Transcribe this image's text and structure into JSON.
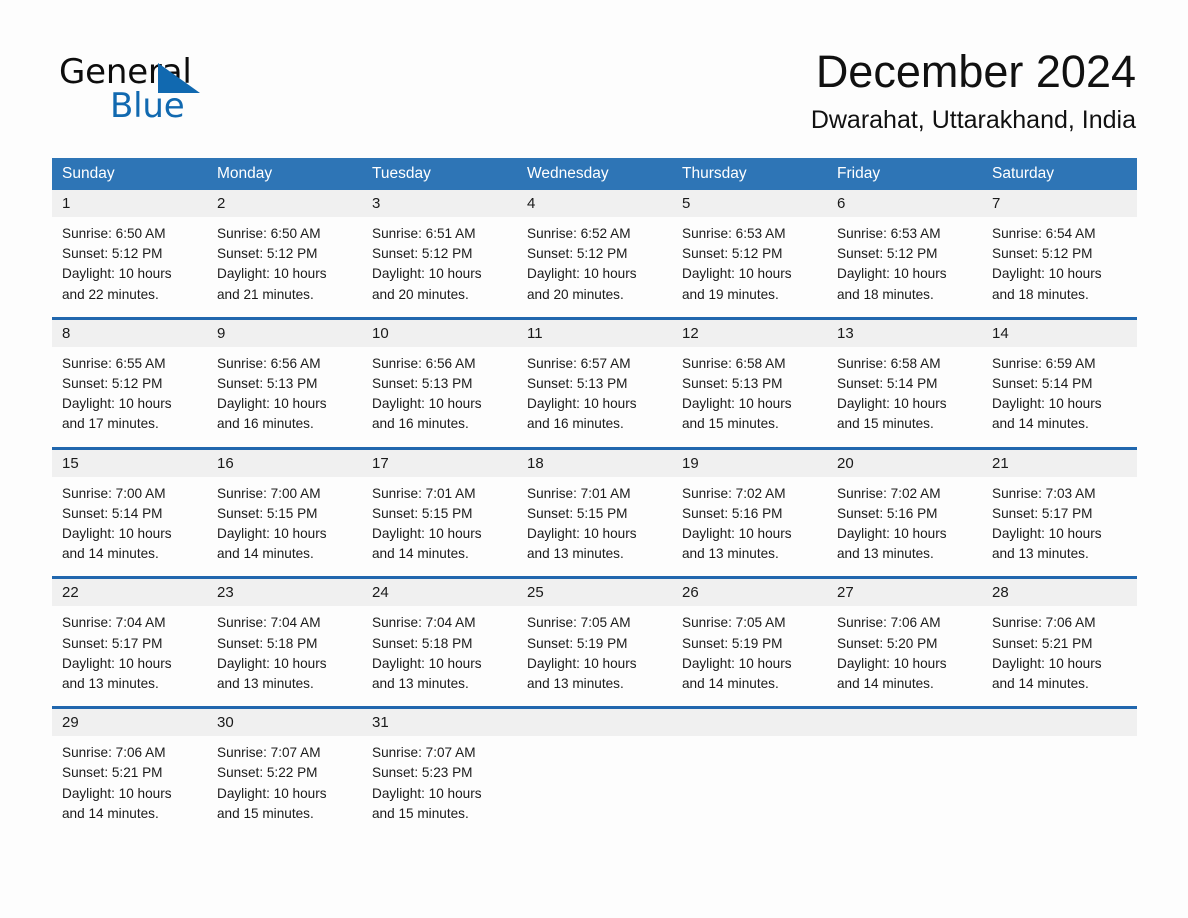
{
  "logo": {
    "word_one": "General",
    "word_two": "Blue",
    "triangle_icon": "triangle-icon",
    "accent_color": "#1169b0"
  },
  "header": {
    "month_title": "December 2024",
    "location": "Dwarahat, Uttarakhand, India"
  },
  "colors": {
    "header_blue": "#2e75b6",
    "row_border_blue": "#2167ae",
    "day_band_gray": "#f0f0f0",
    "page_background": "#fdfdfd"
  },
  "calendar": {
    "weekdays": [
      "Sunday",
      "Monday",
      "Tuesday",
      "Wednesday",
      "Thursday",
      "Friday",
      "Saturday"
    ],
    "weeks": [
      {
        "days": [
          {
            "date": "1",
            "sunrise": "Sunrise: 6:50 AM",
            "sunset": "Sunset: 5:12 PM",
            "daylight_line1": "Daylight: 10 hours",
            "daylight_line2": "and 22 minutes."
          },
          {
            "date": "2",
            "sunrise": "Sunrise: 6:50 AM",
            "sunset": "Sunset: 5:12 PM",
            "daylight_line1": "Daylight: 10 hours",
            "daylight_line2": "and 21 minutes."
          },
          {
            "date": "3",
            "sunrise": "Sunrise: 6:51 AM",
            "sunset": "Sunset: 5:12 PM",
            "daylight_line1": "Daylight: 10 hours",
            "daylight_line2": "and 20 minutes."
          },
          {
            "date": "4",
            "sunrise": "Sunrise: 6:52 AM",
            "sunset": "Sunset: 5:12 PM",
            "daylight_line1": "Daylight: 10 hours",
            "daylight_line2": "and 20 minutes."
          },
          {
            "date": "5",
            "sunrise": "Sunrise: 6:53 AM",
            "sunset": "Sunset: 5:12 PM",
            "daylight_line1": "Daylight: 10 hours",
            "daylight_line2": "and 19 minutes."
          },
          {
            "date": "6",
            "sunrise": "Sunrise: 6:53 AM",
            "sunset": "Sunset: 5:12 PM",
            "daylight_line1": "Daylight: 10 hours",
            "daylight_line2": "and 18 minutes."
          },
          {
            "date": "7",
            "sunrise": "Sunrise: 6:54 AM",
            "sunset": "Sunset: 5:12 PM",
            "daylight_line1": "Daylight: 10 hours",
            "daylight_line2": "and 18 minutes."
          }
        ]
      },
      {
        "days": [
          {
            "date": "8",
            "sunrise": "Sunrise: 6:55 AM",
            "sunset": "Sunset: 5:12 PM",
            "daylight_line1": "Daylight: 10 hours",
            "daylight_line2": "and 17 minutes."
          },
          {
            "date": "9",
            "sunrise": "Sunrise: 6:56 AM",
            "sunset": "Sunset: 5:13 PM",
            "daylight_line1": "Daylight: 10 hours",
            "daylight_line2": "and 16 minutes."
          },
          {
            "date": "10",
            "sunrise": "Sunrise: 6:56 AM",
            "sunset": "Sunset: 5:13 PM",
            "daylight_line1": "Daylight: 10 hours",
            "daylight_line2": "and 16 minutes."
          },
          {
            "date": "11",
            "sunrise": "Sunrise: 6:57 AM",
            "sunset": "Sunset: 5:13 PM",
            "daylight_line1": "Daylight: 10 hours",
            "daylight_line2": "and 16 minutes."
          },
          {
            "date": "12",
            "sunrise": "Sunrise: 6:58 AM",
            "sunset": "Sunset: 5:13 PM",
            "daylight_line1": "Daylight: 10 hours",
            "daylight_line2": "and 15 minutes."
          },
          {
            "date": "13",
            "sunrise": "Sunrise: 6:58 AM",
            "sunset": "Sunset: 5:14 PM",
            "daylight_line1": "Daylight: 10 hours",
            "daylight_line2": "and 15 minutes."
          },
          {
            "date": "14",
            "sunrise": "Sunrise: 6:59 AM",
            "sunset": "Sunset: 5:14 PM",
            "daylight_line1": "Daylight: 10 hours",
            "daylight_line2": "and 14 minutes."
          }
        ]
      },
      {
        "days": [
          {
            "date": "15",
            "sunrise": "Sunrise: 7:00 AM",
            "sunset": "Sunset: 5:14 PM",
            "daylight_line1": "Daylight: 10 hours",
            "daylight_line2": "and 14 minutes."
          },
          {
            "date": "16",
            "sunrise": "Sunrise: 7:00 AM",
            "sunset": "Sunset: 5:15 PM",
            "daylight_line1": "Daylight: 10 hours",
            "daylight_line2": "and 14 minutes."
          },
          {
            "date": "17",
            "sunrise": "Sunrise: 7:01 AM",
            "sunset": "Sunset: 5:15 PM",
            "daylight_line1": "Daylight: 10 hours",
            "daylight_line2": "and 14 minutes."
          },
          {
            "date": "18",
            "sunrise": "Sunrise: 7:01 AM",
            "sunset": "Sunset: 5:15 PM",
            "daylight_line1": "Daylight: 10 hours",
            "daylight_line2": "and 13 minutes."
          },
          {
            "date": "19",
            "sunrise": "Sunrise: 7:02 AM",
            "sunset": "Sunset: 5:16 PM",
            "daylight_line1": "Daylight: 10 hours",
            "daylight_line2": "and 13 minutes."
          },
          {
            "date": "20",
            "sunrise": "Sunrise: 7:02 AM",
            "sunset": "Sunset: 5:16 PM",
            "daylight_line1": "Daylight: 10 hours",
            "daylight_line2": "and 13 minutes."
          },
          {
            "date": "21",
            "sunrise": "Sunrise: 7:03 AM",
            "sunset": "Sunset: 5:17 PM",
            "daylight_line1": "Daylight: 10 hours",
            "daylight_line2": "and 13 minutes."
          }
        ]
      },
      {
        "days": [
          {
            "date": "22",
            "sunrise": "Sunrise: 7:04 AM",
            "sunset": "Sunset: 5:17 PM",
            "daylight_line1": "Daylight: 10 hours",
            "daylight_line2": "and 13 minutes."
          },
          {
            "date": "23",
            "sunrise": "Sunrise: 7:04 AM",
            "sunset": "Sunset: 5:18 PM",
            "daylight_line1": "Daylight: 10 hours",
            "daylight_line2": "and 13 minutes."
          },
          {
            "date": "24",
            "sunrise": "Sunrise: 7:04 AM",
            "sunset": "Sunset: 5:18 PM",
            "daylight_line1": "Daylight: 10 hours",
            "daylight_line2": "and 13 minutes."
          },
          {
            "date": "25",
            "sunrise": "Sunrise: 7:05 AM",
            "sunset": "Sunset: 5:19 PM",
            "daylight_line1": "Daylight: 10 hours",
            "daylight_line2": "and 13 minutes."
          },
          {
            "date": "26",
            "sunrise": "Sunrise: 7:05 AM",
            "sunset": "Sunset: 5:19 PM",
            "daylight_line1": "Daylight: 10 hours",
            "daylight_line2": "and 14 minutes."
          },
          {
            "date": "27",
            "sunrise": "Sunrise: 7:06 AM",
            "sunset": "Sunset: 5:20 PM",
            "daylight_line1": "Daylight: 10 hours",
            "daylight_line2": "and 14 minutes."
          },
          {
            "date": "28",
            "sunrise": "Sunrise: 7:06 AM",
            "sunset": "Sunset: 5:21 PM",
            "daylight_line1": "Daylight: 10 hours",
            "daylight_line2": "and 14 minutes."
          }
        ]
      },
      {
        "days": [
          {
            "date": "29",
            "sunrise": "Sunrise: 7:06 AM",
            "sunset": "Sunset: 5:21 PM",
            "daylight_line1": "Daylight: 10 hours",
            "daylight_line2": "and 14 minutes."
          },
          {
            "date": "30",
            "sunrise": "Sunrise: 7:07 AM",
            "sunset": "Sunset: 5:22 PM",
            "daylight_line1": "Daylight: 10 hours",
            "daylight_line2": "and 15 minutes."
          },
          {
            "date": "31",
            "sunrise": "Sunrise: 7:07 AM",
            "sunset": "Sunset: 5:23 PM",
            "daylight_line1": "Daylight: 10 hours",
            "daylight_line2": "and 15 minutes."
          },
          {
            "date": "",
            "sunrise": "",
            "sunset": "",
            "daylight_line1": "",
            "daylight_line2": ""
          },
          {
            "date": "",
            "sunrise": "",
            "sunset": "",
            "daylight_line1": "",
            "daylight_line2": ""
          },
          {
            "date": "",
            "sunrise": "",
            "sunset": "",
            "daylight_line1": "",
            "daylight_line2": ""
          },
          {
            "date": "",
            "sunrise": "",
            "sunset": "",
            "daylight_line1": "",
            "daylight_line2": ""
          }
        ]
      }
    ]
  }
}
